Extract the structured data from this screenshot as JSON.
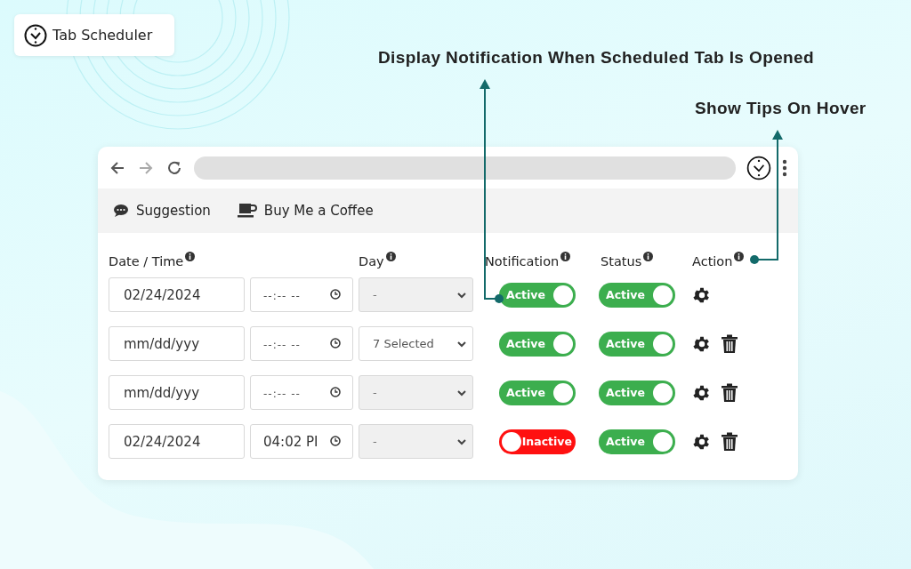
{
  "app_badge": {
    "title": "Tab Scheduler"
  },
  "callouts": [
    {
      "text": "Display Notification When Scheduled Tab Is Opened"
    },
    {
      "text": "Show Tips On Hover"
    }
  ],
  "browser": {
    "menu": [
      {
        "label": "Suggestion",
        "kind": "chat"
      },
      {
        "label": "Buy Me a Coffee",
        "kind": "coffee"
      }
    ]
  },
  "table": {
    "columns": [
      {
        "label": "Date / Time"
      },
      {
        "label": "Day"
      },
      {
        "label": "Notification"
      },
      {
        "label": "Status"
      },
      {
        "label": "Action"
      }
    ],
    "rows": [
      {
        "date": {
          "value": "02/24/2024"
        },
        "time": {
          "placeholder": "--:-- --"
        },
        "day": {
          "value": "-",
          "disabled": true
        },
        "notification": {
          "label": "Active",
          "on": true
        },
        "status": {
          "label": "Active",
          "on": true
        },
        "deletable": false
      },
      {
        "date": {
          "value": "mm/dd/yyy"
        },
        "time": {
          "placeholder": "--:-- --"
        },
        "day": {
          "value": "7 Selected",
          "disabled": false
        },
        "notification": {
          "label": "Active",
          "on": true
        },
        "status": {
          "label": "Active",
          "on": true
        },
        "deletable": true
      },
      {
        "date": {
          "value": "mm/dd/yyy"
        },
        "time": {
          "placeholder": "--:-- --"
        },
        "day": {
          "value": "-",
          "disabled": true
        },
        "notification": {
          "label": "Active",
          "on": true
        },
        "status": {
          "label": "Active",
          "on": true
        },
        "deletable": true
      },
      {
        "date": {
          "value": "02/24/2024"
        },
        "time": {
          "value": "04:02 PI"
        },
        "day": {
          "value": "-",
          "disabled": true
        },
        "notification": {
          "label": "Inactive",
          "on": false
        },
        "status": {
          "label": "Active",
          "on": true
        },
        "deletable": true
      }
    ]
  }
}
